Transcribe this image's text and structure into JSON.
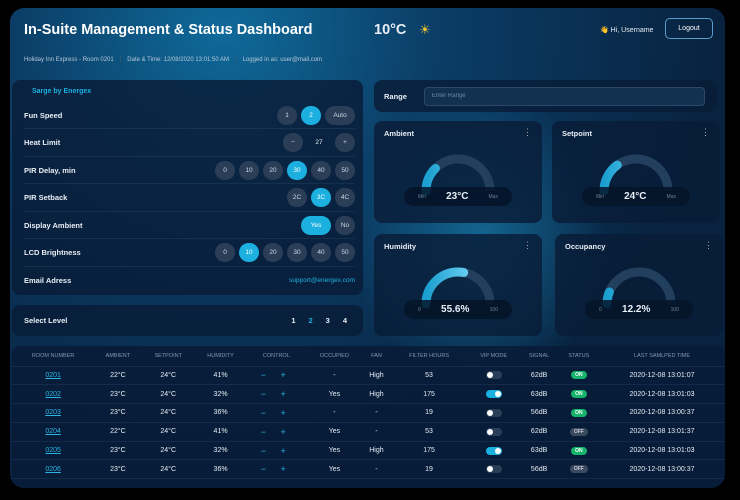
{
  "header": {
    "title": "In-Suite Management & Status Dashboard",
    "temperature": "10°C",
    "weather_icon": "sunrise-icon",
    "greeting": "👋 Hi, Username",
    "logout": "Logout",
    "hotel": "Holiday Inn Express - Room 0201",
    "datetime": "Date & Time: 12/08/2020 13:01:50 AM",
    "logged_in": "Logged in as: user@mail.com"
  },
  "settings": {
    "brand": "Sarge by Energex",
    "fan_speed": {
      "label": "Fun Speed",
      "options": [
        "1",
        "2",
        "Auto"
      ],
      "selected": "2"
    },
    "heat_limit": {
      "label": "Heat Limit",
      "minus": "−",
      "value": "27",
      "plus": "+"
    },
    "pir_delay": {
      "label": "PIR Delay, min",
      "options": [
        "0",
        "10",
        "20",
        "30",
        "40",
        "50"
      ],
      "selected": "30"
    },
    "pir_setback": {
      "label": "PIR Setback",
      "options": [
        "2C",
        "3C",
        "4C"
      ],
      "selected": "3C"
    },
    "display_ambient": {
      "label": "Display Ambient",
      "options": [
        "Yes",
        "No"
      ],
      "selected": "Yes"
    },
    "lcd_brightness": {
      "label": "LCD Brightness",
      "options": [
        "0",
        "10",
        "20",
        "30",
        "40",
        "50"
      ],
      "selected": "10"
    },
    "email": {
      "label": "Email Adress",
      "value": "support@energex.com"
    }
  },
  "level": {
    "label": "Select Level",
    "options": [
      "1",
      "2",
      "3",
      "4"
    ],
    "selected": "2"
  },
  "range": {
    "label": "Range",
    "placeholder": "Enter Range"
  },
  "gauges": [
    {
      "title": "Ambient",
      "value": "23°C",
      "min": "Min",
      "max": "Max",
      "fraction": 0.25
    },
    {
      "title": "Setpoint",
      "value": "24°C",
      "min": "Min",
      "max": "Max",
      "fraction": 0.3
    },
    {
      "title": "Humidity",
      "value": "55.6%",
      "min": "0",
      "max": "100",
      "fraction": 0.556
    },
    {
      "title": "Occupancy",
      "value": "12.2%",
      "min": "0",
      "max": "100",
      "fraction": 0.122
    }
  ],
  "table": {
    "headers": [
      "ROOM NUMBER",
      "AMBIENT",
      "SETPOINT",
      "HUMIDITY",
      "CONTROL",
      "OCCUPIED",
      "FAN",
      "FILTER HOURS",
      "VIP MODE",
      "SIGNAL",
      "STATUS",
      "LAST SAMLPED TIME"
    ],
    "control": "− +",
    "rows": [
      {
        "room": "0201",
        "ambient": "22°C",
        "setpoint": "24°C",
        "humidity": "41%",
        "occupied": "-",
        "fan": "High",
        "filter": "53",
        "vip": false,
        "signal": "62dB",
        "status": "ON",
        "time": "2020-12-08 13:01:07"
      },
      {
        "room": "0202",
        "ambient": "23°C",
        "setpoint": "24°C",
        "humidity": "32%",
        "occupied": "Yes",
        "fan": "High",
        "filter": "175",
        "vip": true,
        "signal": "63dB",
        "status": "ON",
        "time": "2020-12-08 13:01:03"
      },
      {
        "room": "0203",
        "ambient": "23°C",
        "setpoint": "24°C",
        "humidity": "36%",
        "occupied": "-",
        "fan": "-",
        "filter": "19",
        "vip": false,
        "signal": "56dB",
        "status": "ON",
        "time": "2020-12-08 13:00:37"
      },
      {
        "room": "0204",
        "ambient": "22°C",
        "setpoint": "24°C",
        "humidity": "41%",
        "occupied": "Yes",
        "fan": "-",
        "filter": "53",
        "vip": false,
        "signal": "62dB",
        "status": "OFF",
        "time": "2020-12-08 13:01:37"
      },
      {
        "room": "0205",
        "ambient": "23°C",
        "setpoint": "24°C",
        "humidity": "32%",
        "occupied": "Yes",
        "fan": "High",
        "filter": "175",
        "vip": true,
        "signal": "63dB",
        "status": "ON",
        "time": "2020-12-08 13:01:03"
      },
      {
        "room": "0206",
        "ambient": "23°C",
        "setpoint": "24°C",
        "humidity": "36%",
        "occupied": "Yes",
        "fan": "-",
        "filter": "19",
        "vip": false,
        "signal": "56dB",
        "status": "OFF",
        "time": "2020-12-08 13:00:37"
      }
    ]
  }
}
